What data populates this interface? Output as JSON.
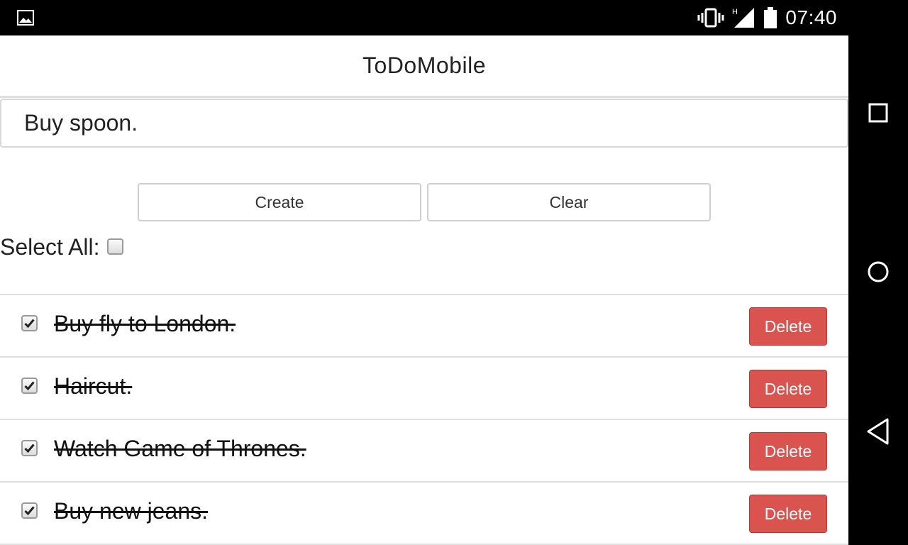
{
  "status_bar": {
    "time": "07:40",
    "icons": [
      "image-icon",
      "vibrate-icon",
      "signal-icon",
      "battery-icon"
    ]
  },
  "app": {
    "title": "ToDoMobile",
    "input": {
      "value": "Buy spoon.",
      "placeholder": ""
    },
    "buttons": {
      "create": "Create",
      "clear": "Clear"
    },
    "select_all_label": "Select All:",
    "select_all_checked": false,
    "todos": [
      {
        "text": "Buy fly to London.",
        "completed": true,
        "delete_label": "Delete"
      },
      {
        "text": "Haircut.",
        "completed": true,
        "delete_label": "Delete"
      },
      {
        "text": "Watch Game of Thrones.",
        "completed": true,
        "delete_label": "Delete"
      },
      {
        "text": "Buy new jeans.",
        "completed": true,
        "delete_label": "Delete"
      }
    ]
  },
  "nav_bar": {
    "icons": [
      "recents-icon",
      "home-icon",
      "back-icon"
    ]
  },
  "colors": {
    "delete": "#d9534f",
    "status_bar": "#000000"
  }
}
